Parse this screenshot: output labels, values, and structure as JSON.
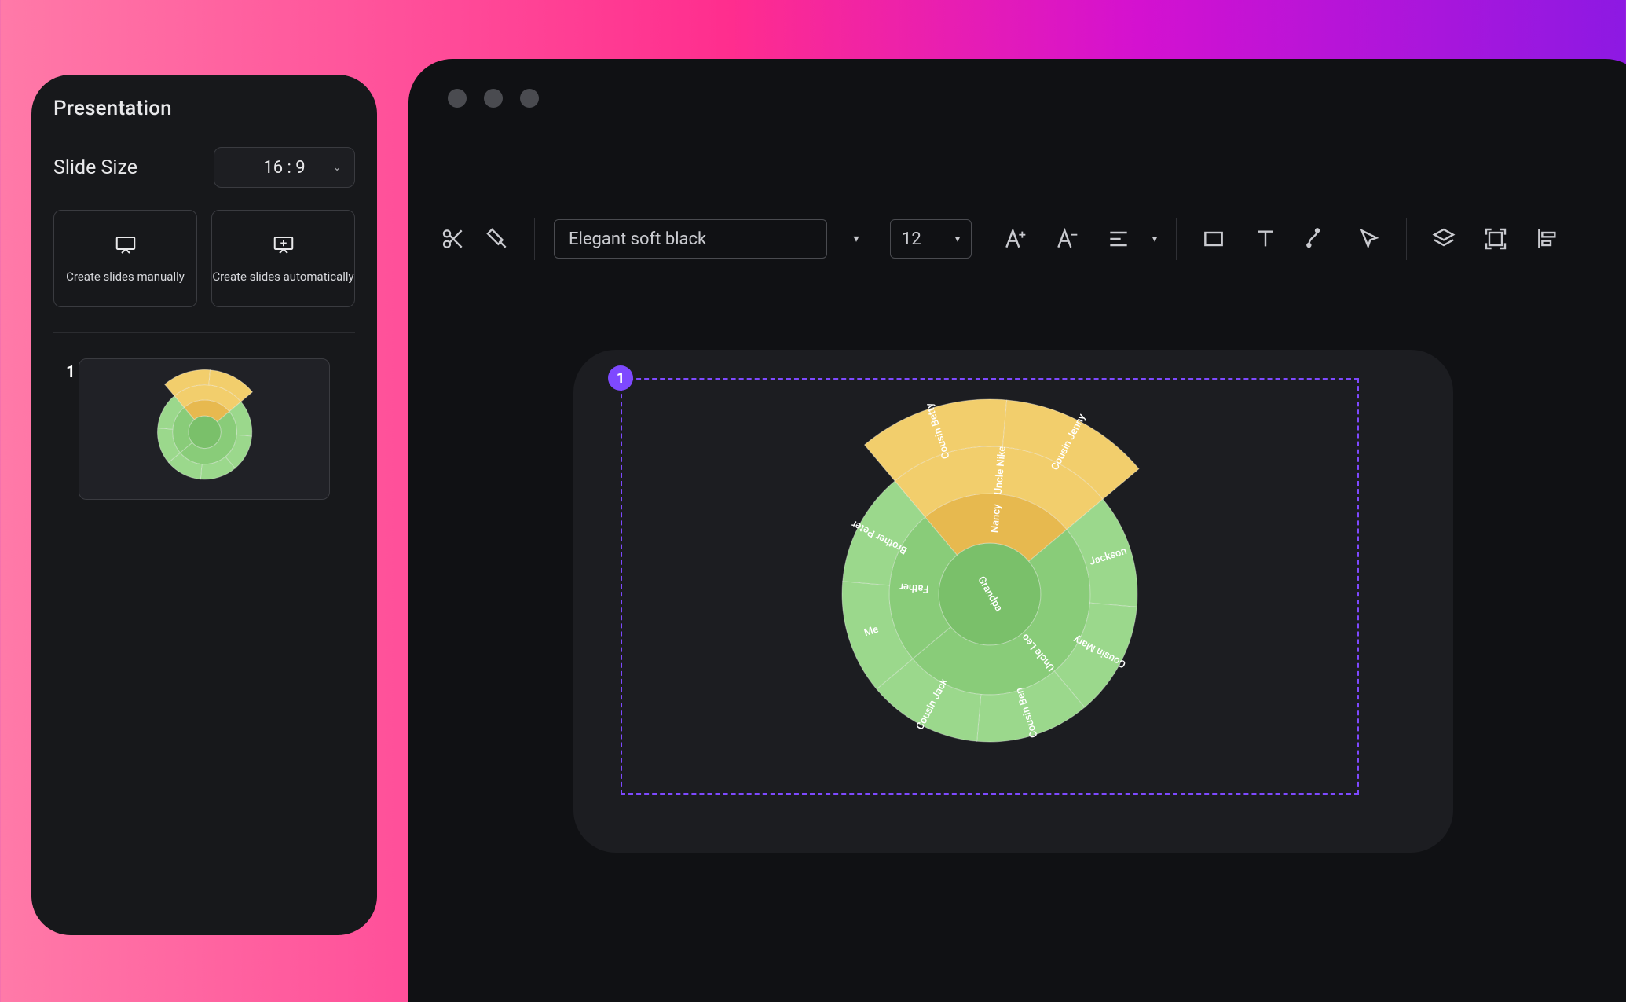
{
  "sidebar": {
    "title": "Presentation",
    "slide_size_label": "Slide Size",
    "slide_size_value": "16 : 9",
    "create_manual": "Create slides manually",
    "create_auto": "Create slides automatically",
    "thumb_number": "1"
  },
  "toolbar": {
    "font_name": "Elegant soft black",
    "font_size": "12"
  },
  "selection": {
    "badge": "1"
  },
  "colors": {
    "green_dark": "#7ac06a",
    "green_mid": "#89cc79",
    "green_light": "#9bd88c",
    "green_pale": "#aee09f",
    "yellow_dark": "#e7b94f",
    "yellow_light": "#f2ce6c"
  },
  "chart_data": {
    "type": "sunburst",
    "title": "",
    "root": {
      "name": "Grandpa",
      "children": [
        {
          "name": "Nancy",
          "highlighted": true,
          "children": [
            {
              "name": "Uncle Nike",
              "highlighted": true,
              "children": [
                {
                  "name": "Cousin Betty",
                  "highlighted": true
                },
                {
                  "name": "Cousin Jenny",
                  "highlighted": true
                }
              ]
            }
          ]
        },
        {
          "name": "Uncle Leo",
          "children": [
            {
              "name": "Jackson"
            },
            {
              "name": "Cousin Mary"
            },
            {
              "name": "Cousin Ben"
            },
            {
              "name": "Cousin Jack"
            }
          ]
        },
        {
          "name": "Father",
          "children": [
            {
              "name": "Me"
            },
            {
              "name": "Brother Peter"
            }
          ]
        }
      ]
    }
  }
}
